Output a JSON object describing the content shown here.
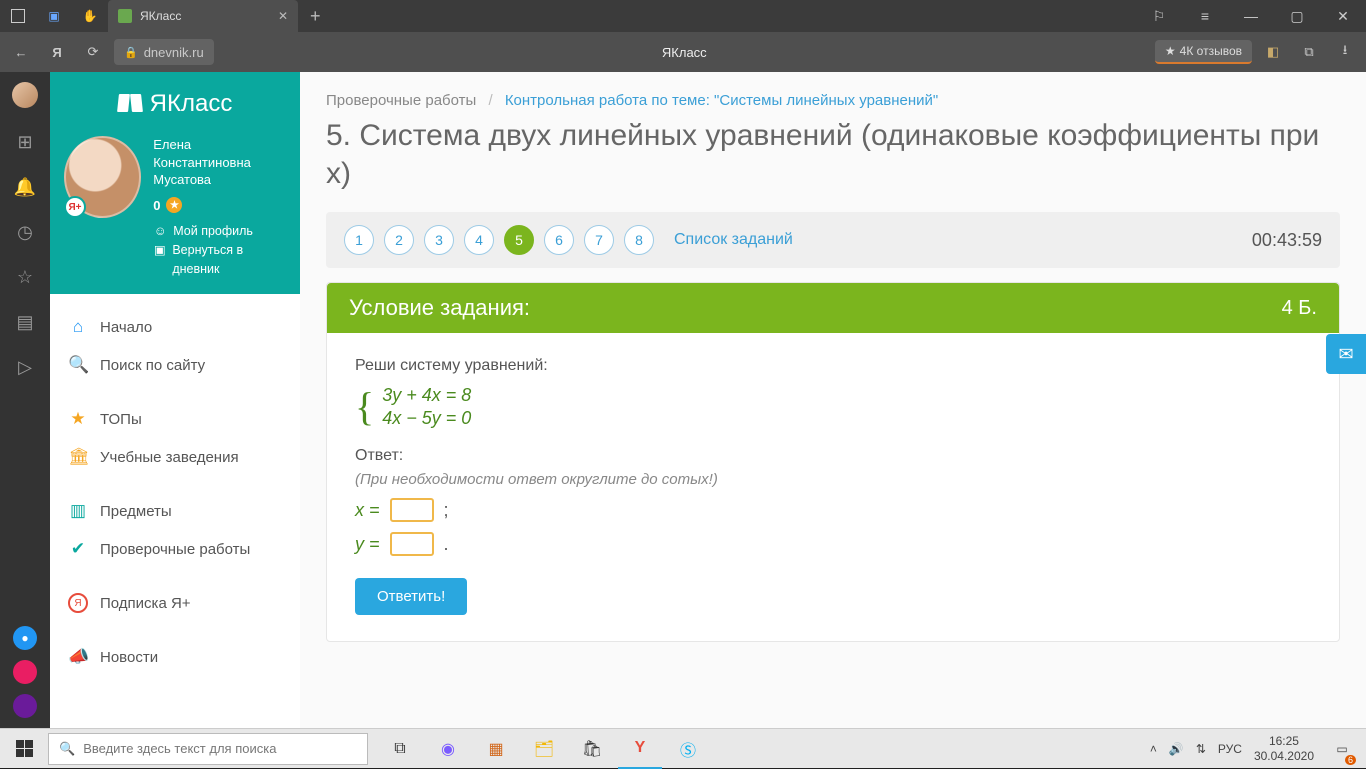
{
  "browser": {
    "tab_title": "ЯКласс",
    "url_host": "dnevnik.ru",
    "page_label": "ЯКласс",
    "reviews": "4К отзывов"
  },
  "sidebar": {
    "brand": "ЯКласс",
    "user_name_l1": "Елена",
    "user_name_l2": "Константиновна",
    "user_name_l3": "Мусатова",
    "badge": "Я+",
    "points": "0",
    "profile_link": "Мой профиль",
    "back_link": "Вернуться в дневник",
    "menu": {
      "home": "Начало",
      "search": "Поиск по сайту",
      "tops": "ТОПы",
      "schools": "Учебные заведения",
      "subjects": "Предметы",
      "tests": "Проверочные работы",
      "subscribe": "Подписка Я+",
      "news": "Новости"
    }
  },
  "main": {
    "crumb1": "Проверочные работы",
    "crumb2": "Контрольная работа по теме: \"Системы линейных уравнений\"",
    "title": "5. Система двух линейных уравнений (одинаковые коэффициенты при x)",
    "steps": [
      "1",
      "2",
      "3",
      "4",
      "5",
      "6",
      "7",
      "8"
    ],
    "active_step_index": 4,
    "step_list": "Список заданий",
    "timer": "00:43:59",
    "panel_title": "Условие задания:",
    "panel_points": "4 Б.",
    "prompt": "Реши систему уравнений:",
    "eq1": "3y + 4x = 8",
    "eq2": "4x − 5y = 0",
    "answer_label": "Ответ:",
    "answer_hint": "(При необходимости ответ округлите до сотых!)",
    "var_x": "x =",
    "var_y": "y =",
    "semicolon": ";",
    "period": ".",
    "submit": "Ответить!"
  },
  "taskbar": {
    "search_placeholder": "Введите здесь текст для поиска",
    "lang": "РУС",
    "time": "16:25",
    "date": "30.04.2020",
    "notif_count": "6"
  }
}
